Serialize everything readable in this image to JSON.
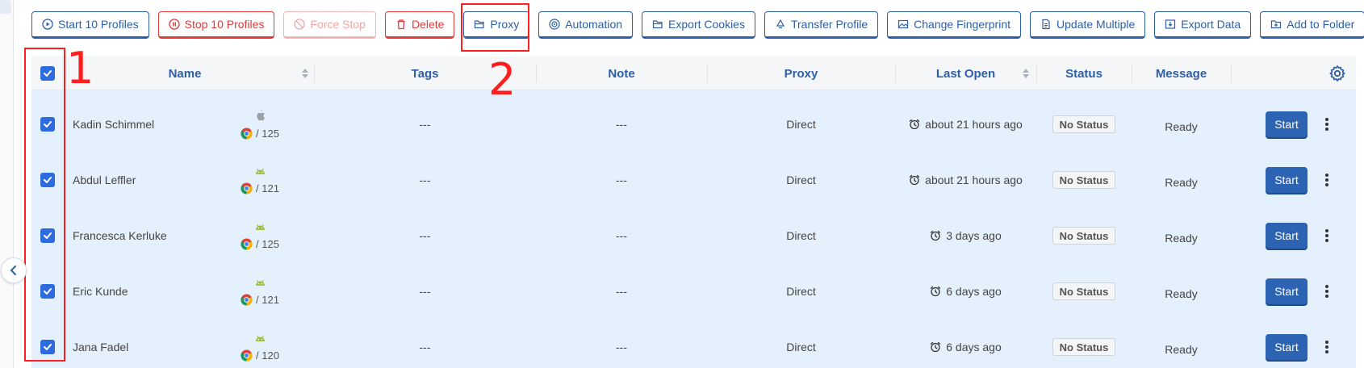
{
  "toolbar": {
    "start_profiles": "Start 10 Profiles",
    "stop_profiles": "Stop 10 Profiles",
    "force_stop": "Force Stop",
    "delete": "Delete",
    "proxy": "Proxy",
    "automation": "Automation",
    "export_cookies": "Export Cookies",
    "transfer_profile": "Transfer Profile",
    "change_fingerprint": "Change Fingerprint",
    "update_multiple": "Update Multiple",
    "export_data": "Export Data",
    "add_to_folder": "Add to Folder"
  },
  "annotations": {
    "one": "1",
    "two": "2",
    "color": "#ff1f1f"
  },
  "table": {
    "headers": {
      "name": "Name",
      "tags": "Tags",
      "note": "Note",
      "proxy": "Proxy",
      "last_open": "Last Open",
      "status": "Status",
      "message": "Message"
    },
    "rows": [
      {
        "name": "Kadin Schimmel",
        "os": "apple",
        "version": "/ 125",
        "tags": "---",
        "note": "---",
        "proxy": "Direct",
        "last_open": "about 21 hours ago",
        "status": "No Status",
        "message": "Ready",
        "action": "Start",
        "checked": true
      },
      {
        "name": "Abdul Leffler",
        "os": "android",
        "version": "/ 121",
        "tags": "---",
        "note": "---",
        "proxy": "Direct",
        "last_open": "about 21 hours ago",
        "status": "No Status",
        "message": "Ready",
        "action": "Start",
        "checked": true
      },
      {
        "name": "Francesca Kerluke",
        "os": "android",
        "version": "/ 125",
        "tags": "---",
        "note": "---",
        "proxy": "Direct",
        "last_open": "3 days ago",
        "status": "No Status",
        "message": "Ready",
        "action": "Start",
        "checked": true
      },
      {
        "name": "Eric Kunde",
        "os": "android",
        "version": "/ 121",
        "tags": "---",
        "note": "---",
        "proxy": "Direct",
        "last_open": "6 days ago",
        "status": "No Status",
        "message": "Ready",
        "action": "Start",
        "checked": true
      },
      {
        "name": "Jana Fadel",
        "os": "android",
        "version": "/ 120",
        "tags": "---",
        "note": "---",
        "proxy": "Direct",
        "last_open": "6 days ago",
        "status": "No Status",
        "message": "Ready",
        "action": "Start",
        "checked": true
      }
    ]
  },
  "colors": {
    "primary": "#2d5fa8",
    "danger": "#e03b3b",
    "row_bg": "#e4f0fb",
    "start_button": "#2c63b3",
    "android_green": "#9bc33c"
  }
}
